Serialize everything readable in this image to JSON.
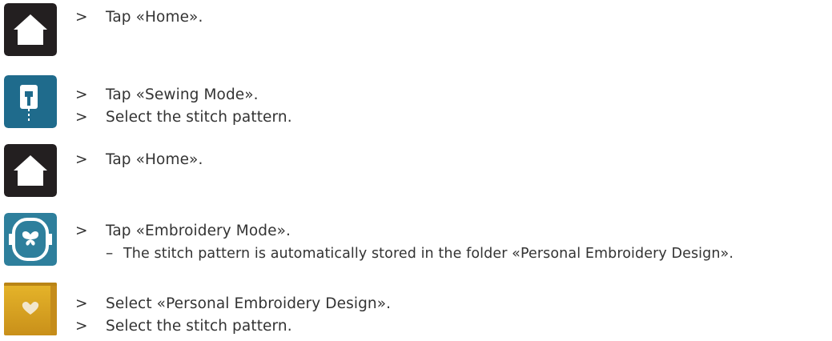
{
  "colors": {
    "home_icon_bg": "#231f20",
    "sewing_icon_bg": "#1f6b8c",
    "embroidery_icon_bg": "#2e7f9c",
    "folder_icon_bg": "#d9a21b",
    "text": "#333333"
  },
  "steps": [
    {
      "icon": "home-icon",
      "marker": ">",
      "text": "Tap «Home»."
    },
    {
      "icon": "sewing-mode-icon",
      "marker": ">",
      "text": "Tap «Sewing Mode»."
    },
    {
      "marker": ">",
      "text": "Select the stitch pattern."
    },
    {
      "icon": "home-icon",
      "marker": ">",
      "text": "Tap «Home»."
    },
    {
      "icon": "embroidery-mode-icon",
      "marker": ">",
      "text": "Tap «Embroidery Mode»."
    },
    {
      "marker": "–",
      "text": "The stitch pattern is automatically stored in the folder «Personal Embroidery Design»."
    },
    {
      "icon": "personal-embroidery-folder-icon",
      "marker": ">",
      "text": "Select «Personal Embroidery Design»."
    },
    {
      "marker": ">",
      "text": "Select the stitch pattern."
    }
  ]
}
